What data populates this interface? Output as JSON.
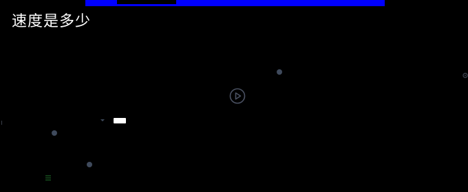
{
  "header": {
    "title": "速度是多少"
  },
  "colors": {
    "background": "#000000",
    "accent_bar": "#0000ff",
    "title_text": "#ffffff",
    "play_icon": "#4b5263",
    "marker": "#3f4a5c",
    "chip": "#ffffff",
    "hamburger": "#1f6f2a",
    "gear": "#3a3f4a"
  },
  "icons": {
    "play": "play-circle-icon",
    "settings": "gear-icon",
    "menu": "hamburger-icon",
    "dropdown": "chevron-down-icon"
  }
}
